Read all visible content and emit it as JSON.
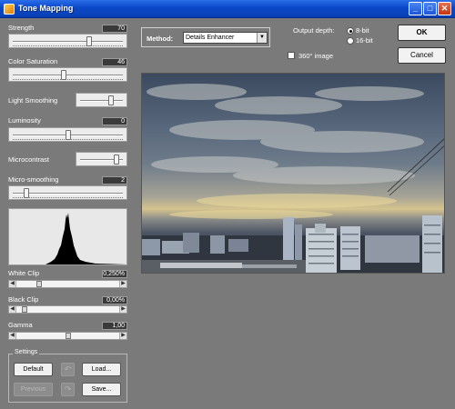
{
  "window": {
    "title": "Tone Mapping",
    "min": "_",
    "max": "□",
    "close": "✕"
  },
  "sliders": {
    "strength": {
      "label": "Strength",
      "value": "70",
      "level": 0.7
    },
    "color_saturation": {
      "label": "Color Saturation",
      "value": "46",
      "level": 0.46
    },
    "light_smoothing": {
      "label": "Light Smoothing",
      "level": 0.75
    },
    "luminosity": {
      "label": "Luminosity",
      "value": "0",
      "level": 0.5
    },
    "microcontrast": {
      "label": "Microcontrast",
      "level": 0.9
    },
    "micro_smoothing": {
      "label": "Micro-smoothing",
      "value": "2",
      "level": 0.1
    }
  },
  "clips": {
    "white_clip": {
      "label": "White Clip",
      "value": "0,250%",
      "level": 0.2
    },
    "black_clip": {
      "label": "Black Clip",
      "value": "0,00%",
      "level": 0.05
    },
    "gamma": {
      "label": "Gamma",
      "value": "1,00",
      "level": 0.5
    }
  },
  "settings": {
    "label": "Settings",
    "default": "Default",
    "load": "Load...",
    "previous": "Previous",
    "save": "Save..."
  },
  "method": {
    "label": "Method:",
    "selected": "Details Enhancer"
  },
  "output": {
    "label": "Output depth:",
    "options": [
      "8-bit",
      "16-bit"
    ],
    "selected": "8-bit",
    "image_360": "360° image"
  },
  "buttons": {
    "ok": "OK",
    "cancel": "Cancel"
  },
  "icons": {
    "app": "tone-mapping-app-icon",
    "undo": "undo-icon",
    "redo": "redo-icon",
    "dropdown": "chevron-down-icon"
  }
}
